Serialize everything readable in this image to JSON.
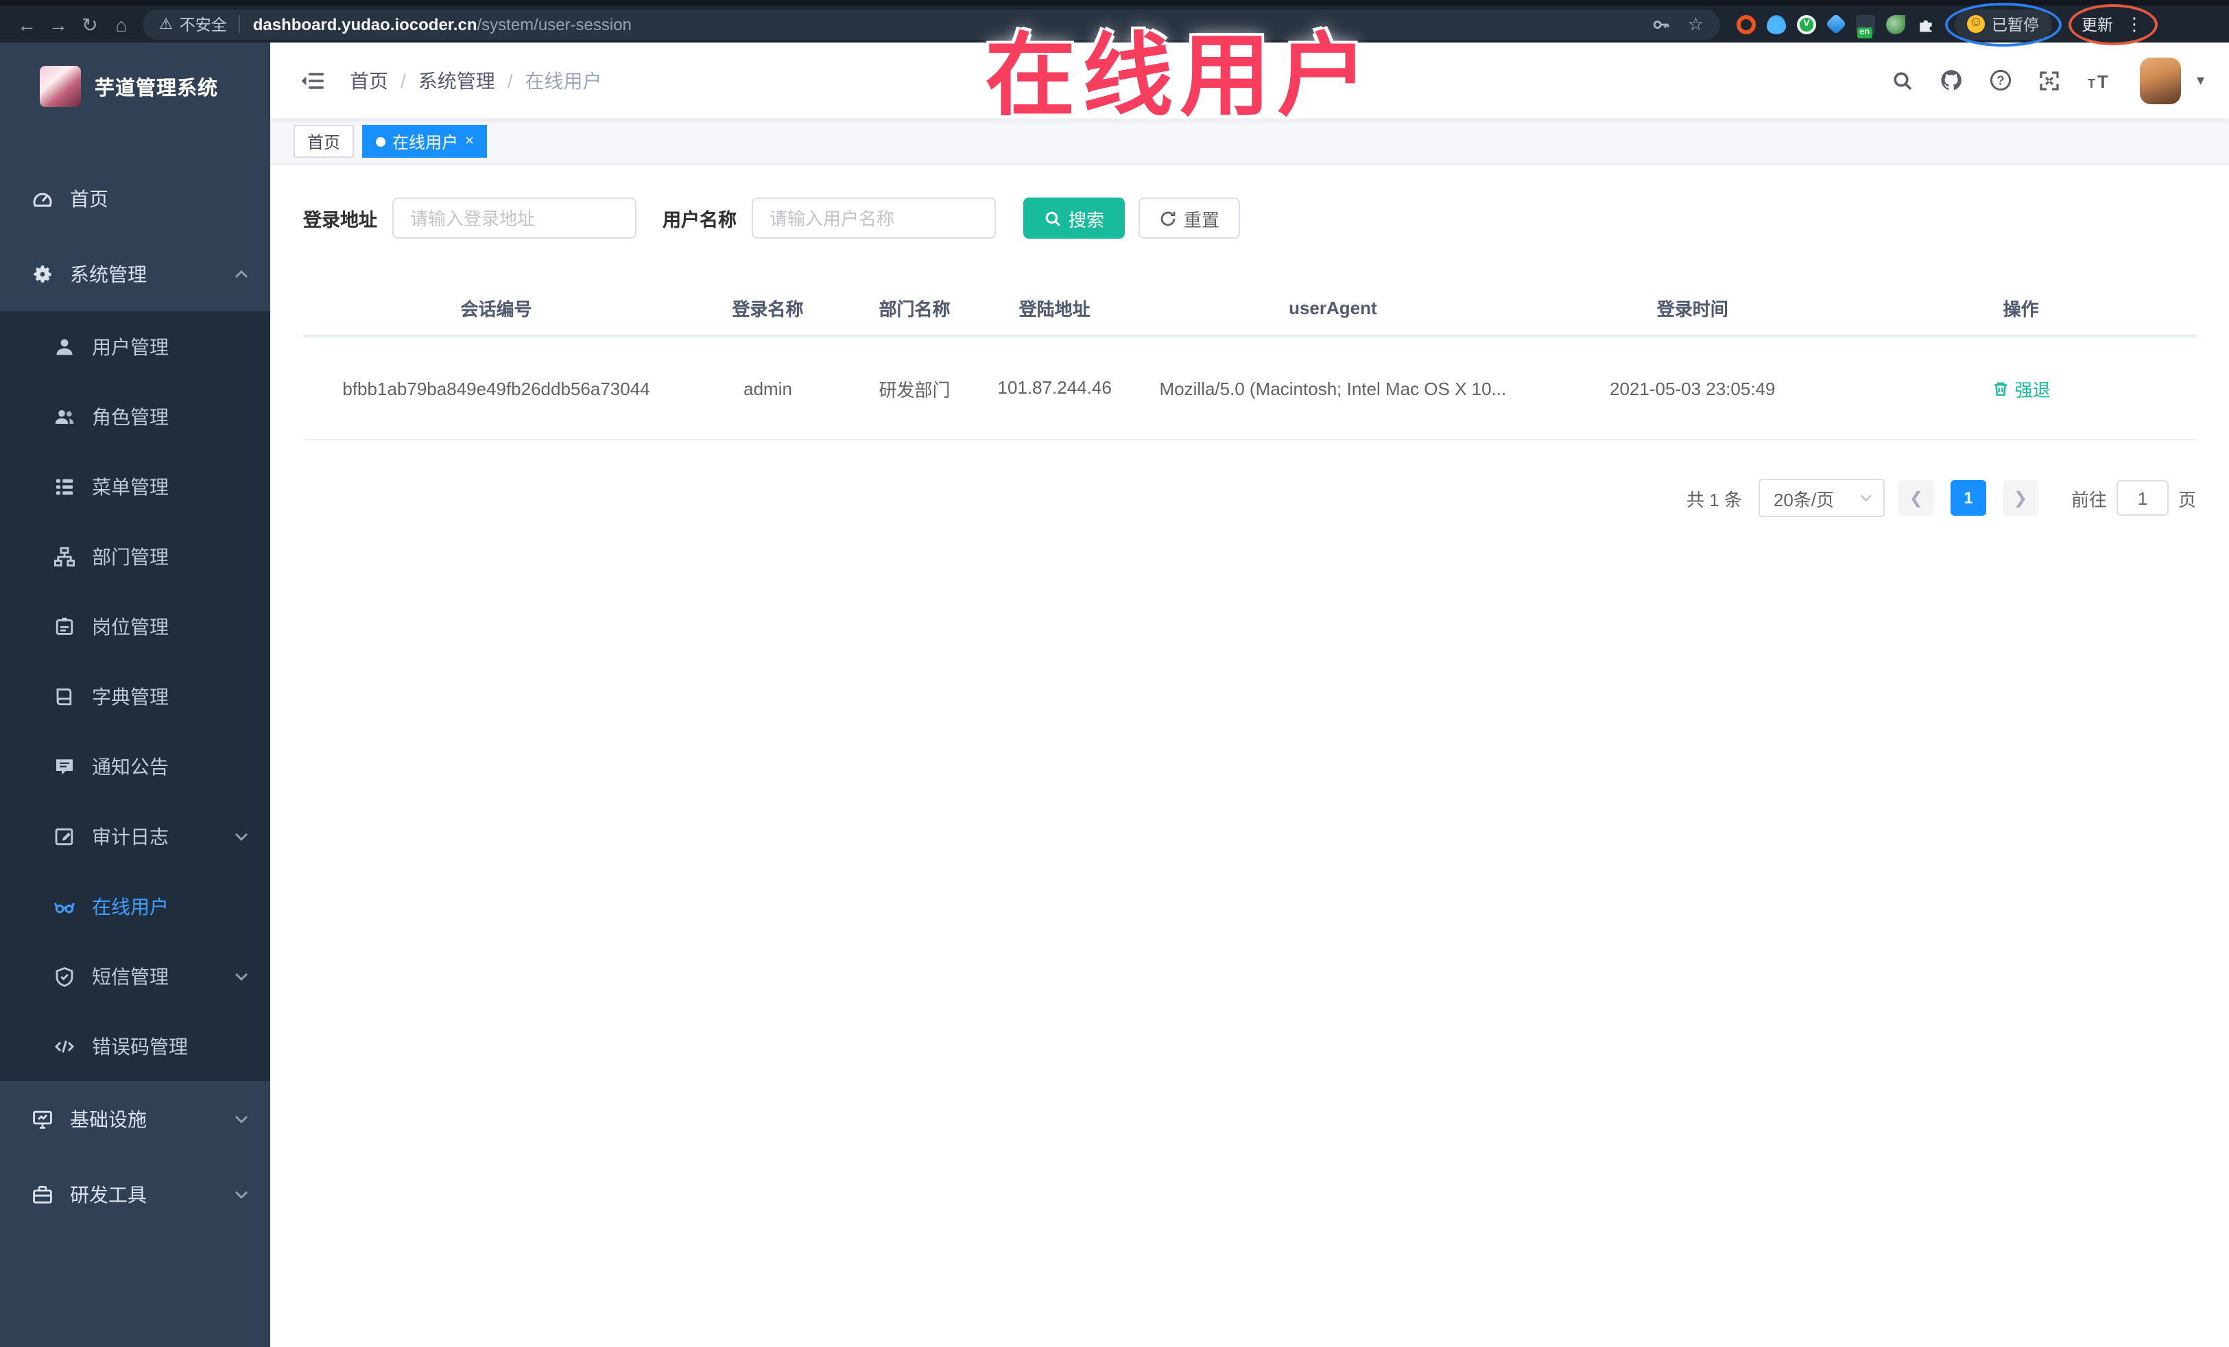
{
  "browser": {
    "security_label": "不安全",
    "url_domain": "dashboard.yudao.iocoder.cn",
    "url_path": "/system/user-session",
    "extension_en_badge": "en",
    "paused_badge": "已暂停",
    "update_button": "更新"
  },
  "annotation": {
    "overlay_text": "在线用户"
  },
  "sidebar": {
    "title": "芋道管理系统",
    "items": [
      {
        "label": "首页"
      },
      {
        "label": "系统管理"
      },
      {
        "label": "用户管理"
      },
      {
        "label": "角色管理"
      },
      {
        "label": "菜单管理"
      },
      {
        "label": "部门管理"
      },
      {
        "label": "岗位管理"
      },
      {
        "label": "字典管理"
      },
      {
        "label": "通知公告"
      },
      {
        "label": "审计日志"
      },
      {
        "label": "在线用户"
      },
      {
        "label": "短信管理"
      },
      {
        "label": "错误码管理"
      },
      {
        "label": "基础设施"
      },
      {
        "label": "研发工具"
      }
    ]
  },
  "header": {
    "breadcrumb": [
      "首页",
      "系统管理",
      "在线用户"
    ],
    "sep": "/"
  },
  "tags": [
    {
      "label": "首页"
    },
    {
      "label": "在线用户",
      "close": "×"
    }
  ],
  "filters": {
    "fields": [
      {
        "label": "登录地址",
        "placeholder": "请输入登录地址"
      },
      {
        "label": "用户名称",
        "placeholder": "请输入用户名称"
      }
    ],
    "search_label": "搜索",
    "reset_label": "重置"
  },
  "table": {
    "headers": [
      "会话编号",
      "登录名称",
      "部门名称",
      "登陆地址",
      "userAgent",
      "登录时间",
      "操作"
    ],
    "rows": [
      {
        "session_id": "bfbb1ab79ba849e49fb26ddb56a73044",
        "username": "admin",
        "dept": "研发部门",
        "ip": "101.87.244.46",
        "user_agent": "Mozilla/5.0 (Macintosh; Intel Mac OS X 10...",
        "login_time": "2021-05-03 23:05:49",
        "action": "强退"
      }
    ]
  },
  "pagination": {
    "total": "共 1 条",
    "page_size": "20条/页",
    "current_page": "1",
    "jump_prefix": "前往",
    "jump_value": "1",
    "jump_suffix": "页"
  },
  "colors": {
    "accent_blue": "#1890ff",
    "menu_active_blue": "#409eff",
    "theme_teal": "#18bc9c",
    "annotation_red": "#f83e5e",
    "sidebar_bg": "#304156",
    "submenu_bg": "#1f2d3d"
  }
}
